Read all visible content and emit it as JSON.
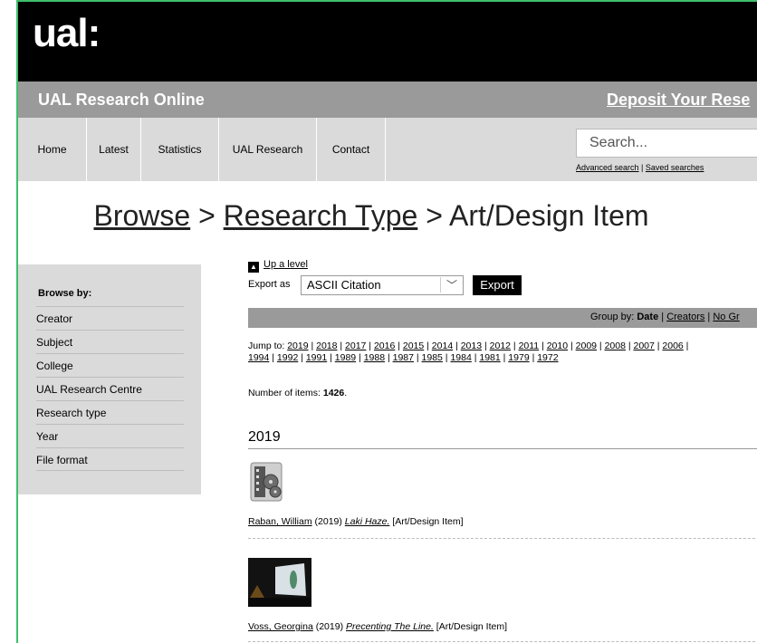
{
  "header": {
    "logo": "ual:",
    "site_title": "UAL Research Online",
    "deposit_link": "Deposit Your Rese"
  },
  "nav": {
    "items": [
      "Home",
      "Latest",
      "Statistics",
      "UAL Research",
      "Contact"
    ]
  },
  "search": {
    "placeholder": "Search...",
    "advanced": "Advanced search",
    "separator": " | ",
    "saved": "Saved searches"
  },
  "breadcrumb": {
    "browse": "Browse",
    "sep1": " > ",
    "type": "Research Type",
    "sep2": " > ",
    "current": "Art/Design Item"
  },
  "sidebar": {
    "heading": "Browse by:",
    "items": [
      "Creator",
      "Subject",
      "College",
      "UAL Research Centre",
      "Research type",
      "Year",
      "File format"
    ]
  },
  "main": {
    "up_level": "Up a level",
    "export_label": "Export as",
    "export_select": "ASCII Citation",
    "export_button": "Export",
    "group_by_label": "Group by: ",
    "group_date": "Date",
    "group_creators": "Creators",
    "group_none": "No Gr",
    "jump_label": "Jump to: ",
    "jump_years_line1": [
      "2019",
      "2018",
      "2017",
      "2016",
      "2015",
      "2014",
      "2013",
      "2012",
      "2011",
      "2010",
      "2009",
      "2008",
      "2007",
      "2006"
    ],
    "jump_years_line2": [
      "1994",
      "1992",
      "1991",
      "1989",
      "1988",
      "1987",
      "1985",
      "1984",
      "1981",
      "1979",
      "1972"
    ],
    "count_label": "Number of items: ",
    "count_value": "1426",
    "year_heading": "2019",
    "items": [
      {
        "author": "Raban, William",
        "year": " (2019) ",
        "title": "Laki Haze.",
        "type": " [Art/Design Item]"
      },
      {
        "author": "Voss, Georgina",
        "year": " (2019) ",
        "title": "Precenting The Line.",
        "type": " [Art/Design Item]"
      }
    ]
  }
}
